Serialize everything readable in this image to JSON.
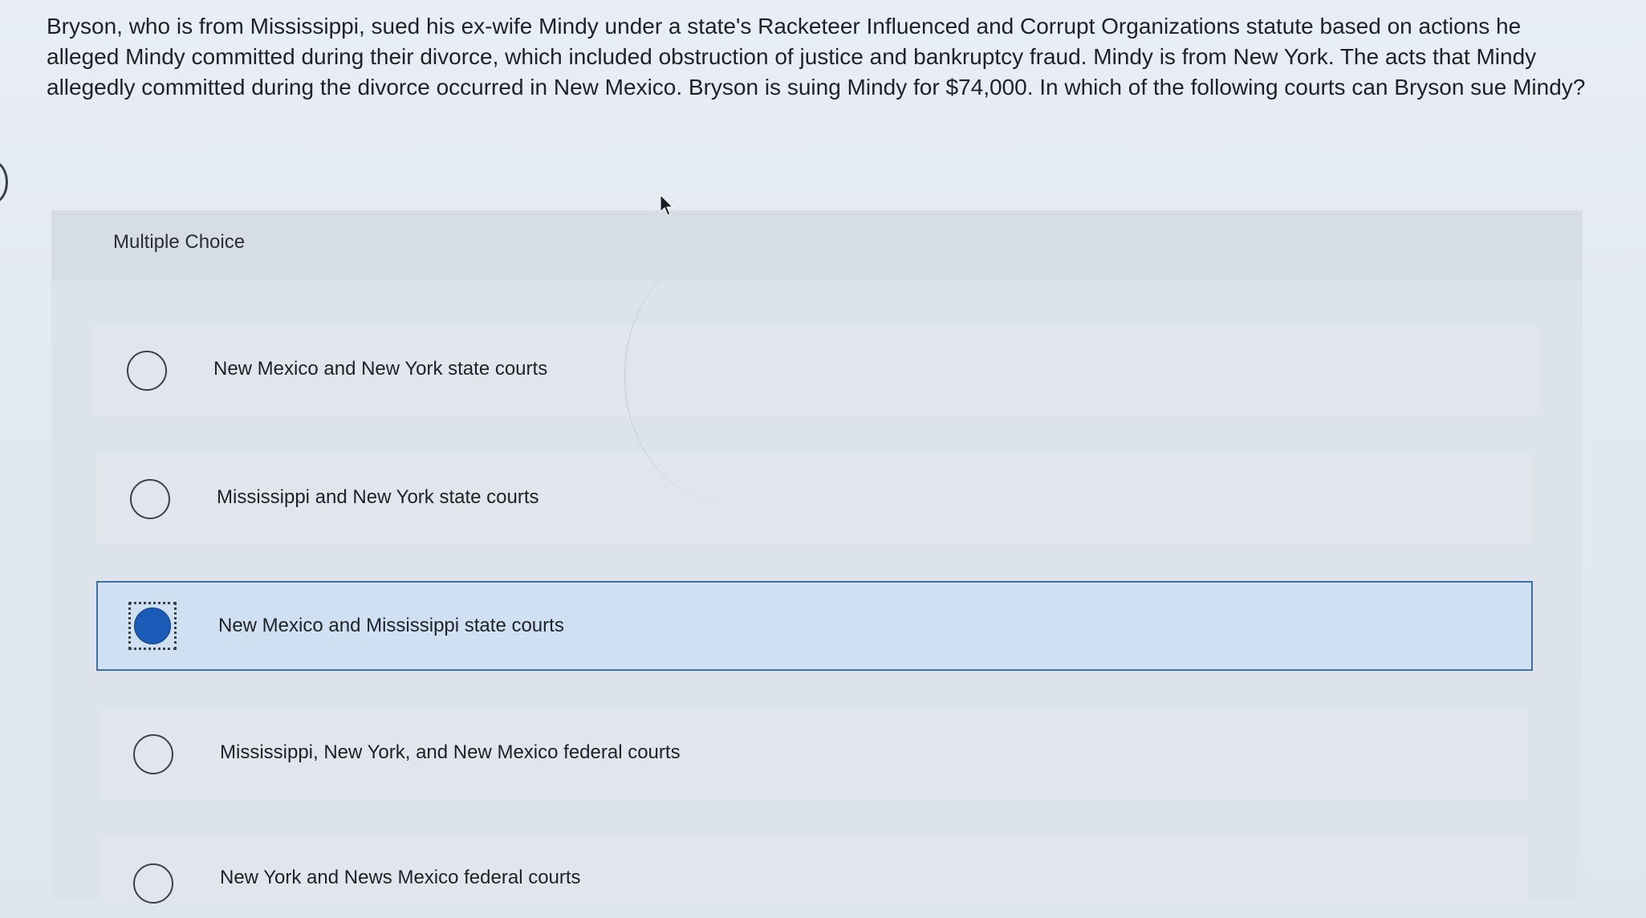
{
  "question": {
    "text": "Bryson, who is from Mississippi, sued his ex-wife Mindy under a state's Racketeer Influenced and Corrupt Organizations statute based on actions he alleged Mindy committed during their divorce, which included obstruction of justice and bankruptcy fraud.  Mindy is from New York.  The acts that Mindy allegedly committed during the divorce occurred in New Mexico.  Bryson is suing Mindy for $74,000. In which of the following courts can Bryson sue Mindy?"
  },
  "choice_panel": {
    "title": "Multiple Choice",
    "options": [
      {
        "label": "New Mexico and New York state courts",
        "selected": false
      },
      {
        "label": "Mississippi and New York state courts",
        "selected": false
      },
      {
        "label": "New Mexico and Mississippi state courts",
        "selected": true
      },
      {
        "label": "Mississippi, New York, and New Mexico federal courts",
        "selected": false
      },
      {
        "label": "New York and News Mexico federal courts",
        "selected": false
      }
    ]
  },
  "colors": {
    "selected_fill": "#cfe0f2",
    "selected_border": "#3f6f9f",
    "radio_selected": "#1b5bb8"
  },
  "icons": {
    "cursor": "mouse-pointer-icon",
    "radio": "radio-button-icon"
  }
}
